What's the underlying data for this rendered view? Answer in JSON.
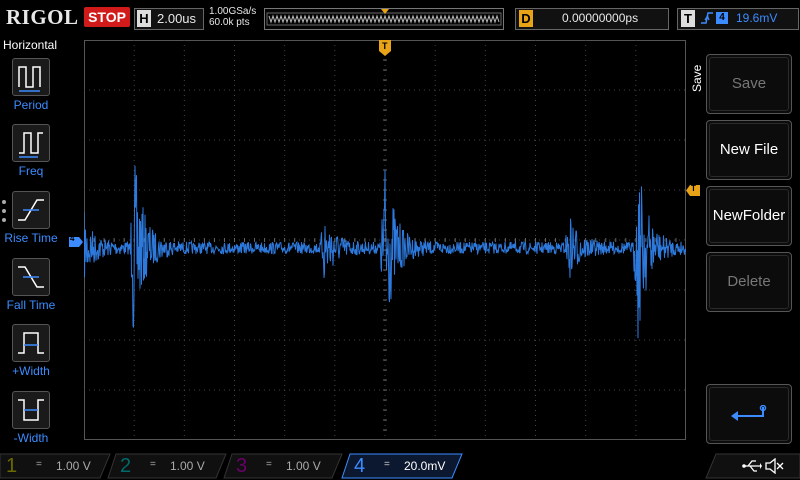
{
  "brand": "RIGOL",
  "run_state": "STOP",
  "timebase": {
    "label": "H",
    "value": "2.00us"
  },
  "sample": {
    "rate": "1.00GSa/s",
    "points": "60.0k pts"
  },
  "delay": {
    "label": "D",
    "value": "0.00000000ps"
  },
  "trigger": {
    "label": "T",
    "edge_icon": "rising-edge-icon",
    "source": "4",
    "level": "19.6mV"
  },
  "left_menu": {
    "title": "Horizontal",
    "items": [
      {
        "label": "Period",
        "icon": "period-icon"
      },
      {
        "label": "Freq",
        "icon": "frequency-icon"
      },
      {
        "label": "Rise Time",
        "icon": "rise-time-icon"
      },
      {
        "label": "Fall Time",
        "icon": "fall-time-icon"
      },
      {
        "label": "+Width",
        "icon": "positive-width-icon"
      },
      {
        "label": "-Width",
        "icon": "negative-width-icon"
      }
    ]
  },
  "right_menu": {
    "title": "Save",
    "buttons": [
      {
        "label": "Save",
        "enabled": false
      },
      {
        "label": "New File",
        "enabled": true
      },
      {
        "label": "NewFolder",
        "enabled": true
      },
      {
        "label": "Delete",
        "enabled": false
      },
      {
        "label": "",
        "icon": "enter-icon",
        "enabled": true
      }
    ]
  },
  "channels": [
    {
      "num": "1",
      "coupling": "=",
      "scale": "1.00 V",
      "color": "#c8c800"
    },
    {
      "num": "2",
      "coupling": "=",
      "scale": "1.00 V",
      "color": "#00c8c8"
    },
    {
      "num": "3",
      "coupling": "=",
      "scale": "1.00 V",
      "color": "#c800c8"
    },
    {
      "num": "4",
      "coupling": "=",
      "scale": "20.0mV",
      "color": "#3c8cff"
    }
  ],
  "markers": {
    "trigger_pos": "T",
    "channel_ref": "4",
    "trigger_level": "T"
  },
  "colors": {
    "accent": "#3c8cff",
    "trigger": "#e8a317",
    "stop": "#d11b1b"
  }
}
